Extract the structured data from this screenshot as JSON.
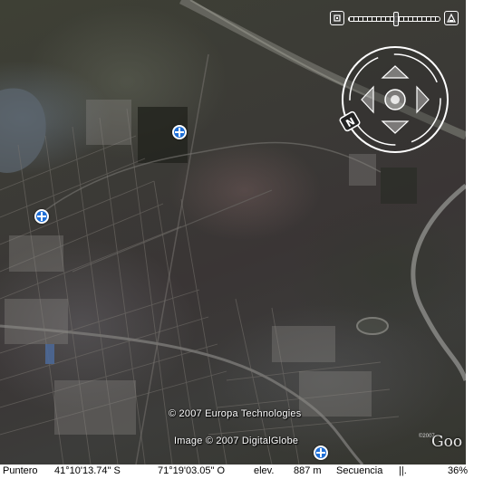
{
  "map": {
    "copyright_data": "© 2007 Europa Technologies",
    "copyright_imagery": "Image © 2007 DigitalGlobe",
    "logo_copyright": "©2007",
    "logo_text": "Goo",
    "zoom_level_fraction": 0.52
  },
  "status_bar": {
    "pointer_label": "Puntero",
    "latitude": "41°10'13.74\" S",
    "longitude": "71°19'03.05\" O",
    "elevation_label": "elev.",
    "elevation_value": "887 m",
    "stream_label": "Secuencia",
    "stream_indicator": "||.",
    "stream_percent": "36%"
  },
  "icons": {
    "zoom_out": "zoom-out-icon",
    "zoom_in": "zoom-in-icon",
    "compass": "compass-ring-icon",
    "north": "north-indicator-icon",
    "pan_arrows": "pan-arrow-icon",
    "placemark": "placemark-icon"
  },
  "colors": {
    "imagery_base": "#3b3a36",
    "placemark": "#1f6fd6",
    "controls": "#ffffff"
  }
}
